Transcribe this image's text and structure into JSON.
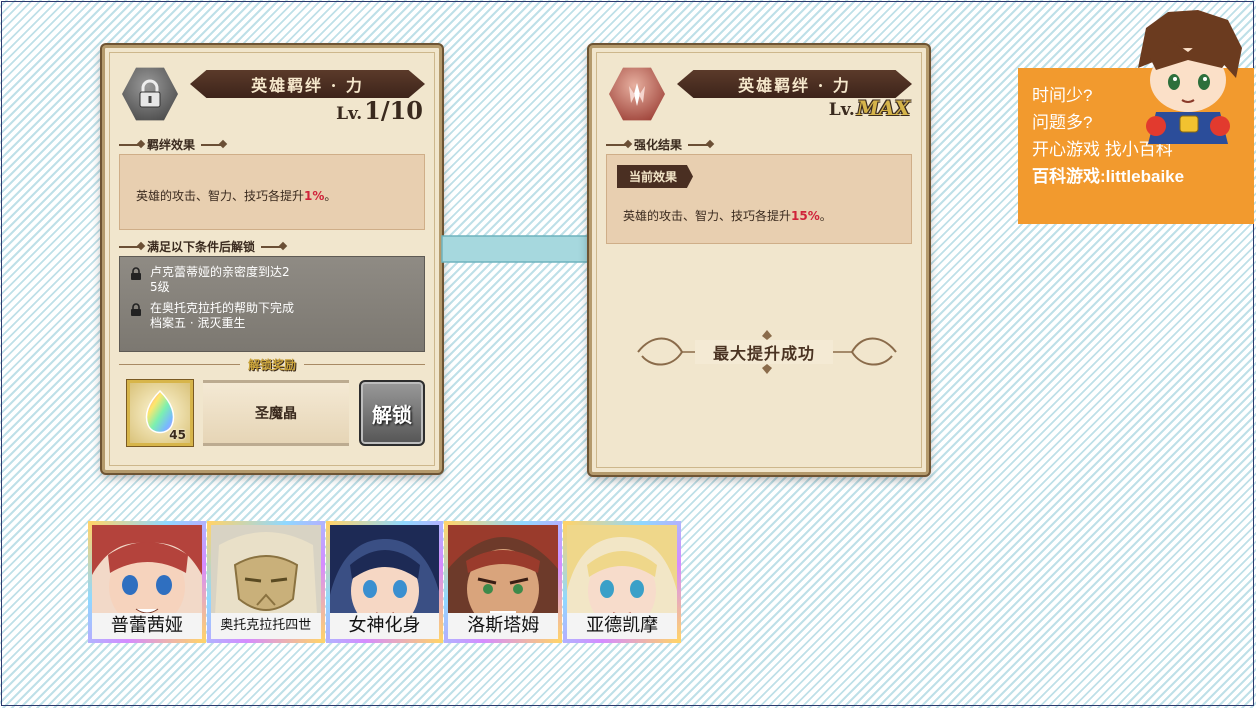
{
  "left_panel": {
    "title": "英雄羁绊 · 力",
    "lv_label": "Lv.",
    "lv_value": "1/10",
    "effect_header": "羁绊效果",
    "effect_prefix": "英雄的攻击、智力、技巧各提升",
    "effect_pct": "1%",
    "effect_suffix": "。",
    "condition_header": "满足以下条件后解锁",
    "conditions": [
      "卢克蕾蒂娅的亲密度到达2\n5级",
      "在奥托克拉托的帮助下完成\n档案五 · 泯灭重生"
    ],
    "reward_label": "解锁奖励",
    "reward_name": "圣魔晶",
    "reward_count": "45",
    "unlock_button": "解锁"
  },
  "right_panel": {
    "title": "英雄羁绊 · 力",
    "lv_label": "Lv.",
    "lv_value": "MAX",
    "result_header": "强化结果",
    "current_tag": "当前效果",
    "effect_prefix": "英雄的攻击、智力、技巧各提升",
    "effect_pct": "15%",
    "effect_suffix": "。",
    "max_banner": "最大提升成功"
  },
  "ad": {
    "line1": "时间少?",
    "line2": "问题多?",
    "line3": "开心游戏 找小百科",
    "line4": "百科游戏:littlebaike",
    "color": "#f29a2e"
  },
  "heroes": [
    {
      "name": "普蕾茜娅",
      "hair": "#b4433c",
      "skin": "#f6d3bd"
    },
    {
      "name": "奥托克拉托四世",
      "hair": "#d8c9a6",
      "skin": "#c9b07a"
    },
    {
      "name": "女神化身",
      "hair": "#1d2a55",
      "skin": "#f6d7c4"
    },
    {
      "name": "洛斯塔姆",
      "hair": "#9a3b2c",
      "skin": "#d9a47c"
    },
    {
      "name": "亚德凯摩",
      "hair": "#efd78a",
      "skin": "#f7dccb"
    }
  ],
  "colors": {
    "accent_red": "#d0233a",
    "arrow": "#9fd5dc",
    "panel_bg": "#f1e6cd"
  }
}
